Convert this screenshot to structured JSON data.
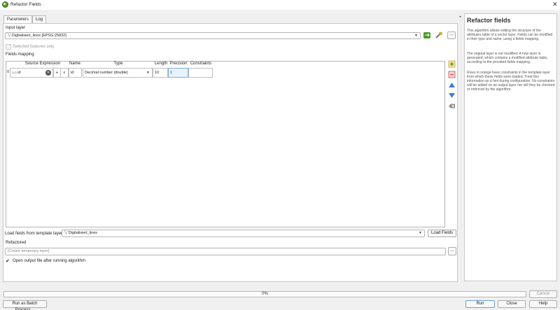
{
  "window": {
    "title": "Refactor Fields"
  },
  "tabs": [
    "Parameters",
    "Log"
  ],
  "params": {
    "input_layer_label": "Input layer",
    "input_layer_value": "Digitalisiert_lines [EPSG:25832]",
    "selected_only_label": "Selected features only",
    "fields_mapping_label": "Fields mapping"
  },
  "table": {
    "headers": [
      "Source Expression",
      "Name",
      "Type",
      "Length",
      "Precision",
      "Constraints"
    ],
    "rows": [
      {
        "index": "0",
        "source_prefix": "123",
        "source": "id",
        "name": "id",
        "type": "Decimal number (double)",
        "length": "10",
        "precision": "1",
        "constraints": ""
      }
    ]
  },
  "template": {
    "label": "Load fields from template layer",
    "value": "Digitalisiert_lines",
    "load_button": "Load Fields"
  },
  "output": {
    "label": "Refactored",
    "placeholder": "[Create temporary layer]",
    "open_label": "Open output file after running algorithm",
    "open_checked": true
  },
  "help": {
    "title": "Refactor fields",
    "paragraphs": [
      "This algorithm allows editing the structure of the attributes table of a vector layer. Fields can be modified in their type and name, using a fields mapping.",
      "The original layer is not modified. A new layer is generated, which contains a modified attribute table, according to the provided fields mapping.",
      "Rows in orange have constraints in the template layer from which these fields were loaded. Treat this information as a hint during configuration. No constraints will be added on an output layer nor will they be checked or enforced by the algorithm."
    ]
  },
  "progress": {
    "value": 0,
    "text": "0%"
  },
  "buttons": {
    "cancel": "Cancel",
    "batch": "Run as Batch Process…",
    "run": "Run",
    "close": "Close",
    "help": "Help"
  },
  "colors": {
    "accent_green": "#4a9a2a",
    "up_arrow": "#3b7fd6",
    "delete_red": "#d9534f"
  }
}
